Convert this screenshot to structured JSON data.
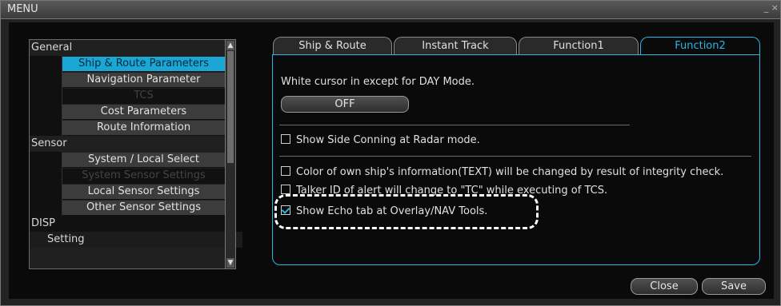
{
  "window": {
    "title": "MENU",
    "controls": "_ ×"
  },
  "tree": {
    "items": [
      {
        "type": "category",
        "label": "General"
      },
      {
        "type": "item",
        "label": "Ship & Route Parameters",
        "state": "selected"
      },
      {
        "type": "item",
        "label": "Navigation Parameter",
        "state": "normal"
      },
      {
        "type": "item",
        "label": "TCS",
        "state": "disabled"
      },
      {
        "type": "item",
        "label": "Cost Parameters",
        "state": "normal"
      },
      {
        "type": "item",
        "label": "Route Information",
        "state": "normal"
      },
      {
        "type": "category",
        "label": "Sensor"
      },
      {
        "type": "item",
        "label": "System / Local Select",
        "state": "normal"
      },
      {
        "type": "item",
        "label": "System Sensor Settings",
        "state": "disabled"
      },
      {
        "type": "item",
        "label": "Local Sensor Settings",
        "state": "normal"
      },
      {
        "type": "item",
        "label": "Other Sensor Settings",
        "state": "normal"
      },
      {
        "type": "category",
        "label": "DISP"
      },
      {
        "type": "category",
        "label": "Setting"
      }
    ]
  },
  "tabs": [
    {
      "label": "Ship & Route",
      "active": false
    },
    {
      "label": "Instant Track",
      "active": false
    },
    {
      "label": "Function1",
      "active": false
    },
    {
      "label": "Function2",
      "active": true
    }
  ],
  "panel": {
    "cursor_label": "White cursor in except for DAY Mode.",
    "cursor_value": "OFF",
    "side_conning": {
      "label": "Show Side Conning at Radar mode.",
      "checked": false
    },
    "color_check": {
      "label": "Color of own ship's information(TEXT) will be changed by result of integrity check.",
      "checked": false
    },
    "talker_id": {
      "label": "Talker ID of alert will change to \"TC\" while executing of TCS.",
      "checked": false
    },
    "echo_tab": {
      "label": "Show Echo tab at Overlay/NAV Tools.",
      "checked": true
    }
  },
  "footer": {
    "close_label": "Close",
    "save_label": "Save"
  },
  "colors": {
    "accent": "#28b7e6",
    "selected": "#1aa7d6",
    "background": "#0a0a0a"
  }
}
